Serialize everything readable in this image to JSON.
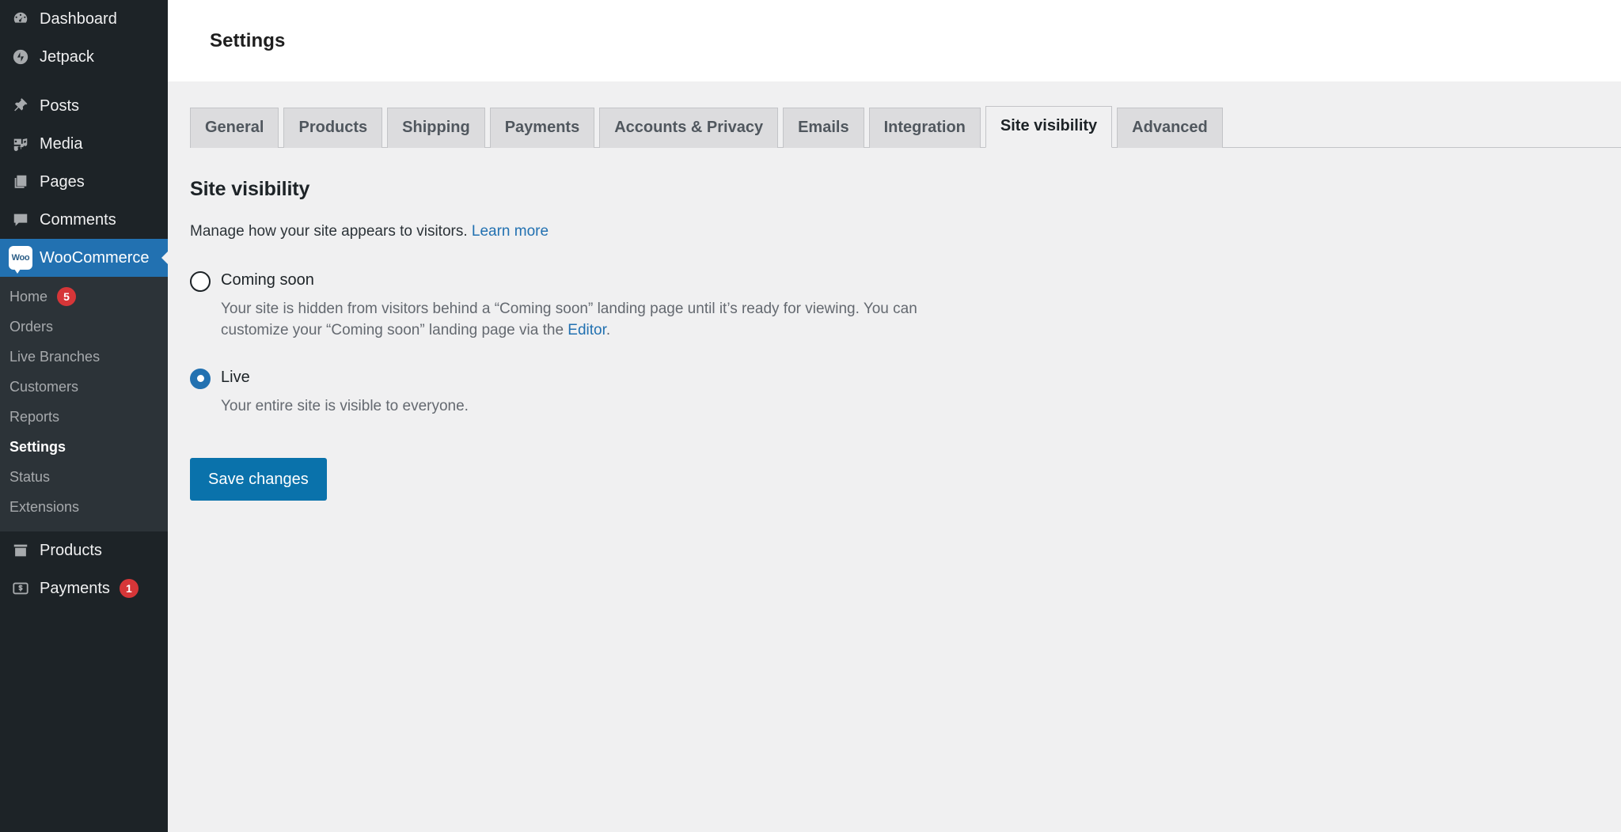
{
  "sidebar": {
    "items": [
      {
        "label": "Dashboard",
        "icon": "dashboard-icon",
        "name": "sidebar-item-dashboard"
      },
      {
        "label": "Jetpack",
        "icon": "jetpack-icon",
        "name": "sidebar-item-jetpack"
      },
      {
        "label": "Posts",
        "icon": "pin-icon",
        "name": "sidebar-item-posts"
      },
      {
        "label": "Media",
        "icon": "media-icon",
        "name": "sidebar-item-media"
      },
      {
        "label": "Pages",
        "icon": "pages-icon",
        "name": "sidebar-item-pages"
      },
      {
        "label": "Comments",
        "icon": "comment-icon",
        "name": "sidebar-item-comments"
      },
      {
        "label": "WooCommerce",
        "icon": "woocommerce-icon",
        "name": "sidebar-item-woocommerce",
        "current": true
      },
      {
        "label": "Products",
        "icon": "box-icon",
        "name": "sidebar-item-products"
      },
      {
        "label": "Payments",
        "icon": "dollar-card-icon",
        "name": "sidebar-item-payments",
        "count": "1"
      }
    ],
    "woo_icon_text": "Woo",
    "submenu": [
      {
        "label": "Home",
        "count": "5"
      },
      {
        "label": "Orders"
      },
      {
        "label": "Live Branches"
      },
      {
        "label": "Customers"
      },
      {
        "label": "Reports"
      },
      {
        "label": "Settings",
        "active": true
      },
      {
        "label": "Status"
      },
      {
        "label": "Extensions"
      }
    ]
  },
  "header": {
    "title": "Settings"
  },
  "tabs": [
    {
      "label": "General"
    },
    {
      "label": "Products"
    },
    {
      "label": "Shipping"
    },
    {
      "label": "Payments"
    },
    {
      "label": "Accounts & Privacy"
    },
    {
      "label": "Emails"
    },
    {
      "label": "Integration"
    },
    {
      "label": "Site visibility",
      "active": true
    },
    {
      "label": "Advanced"
    }
  ],
  "main": {
    "heading": "Site visibility",
    "description_before_link": "Manage how your site appears to visitors. ",
    "learn_more_label": "Learn more",
    "options": [
      {
        "label": "Coming soon",
        "checked": false,
        "help_before_link": "Your site is hidden from visitors behind a “Coming soon” landing page until it’s ready for viewing. You can customize your “Coming soon” landing page via the ",
        "help_link_label": "Editor",
        "help_after_link": "."
      },
      {
        "label": "Live",
        "checked": true,
        "help_before_link": "Your entire site is visible to everyone.",
        "help_link_label": "",
        "help_after_link": ""
      }
    ],
    "save_button": "Save changes"
  },
  "colors": {
    "sidebar_bg": "#1d2327",
    "submenu_bg": "#2c3338",
    "accent_blue": "#2271b1",
    "button_blue": "#0a72ab",
    "badge_red": "#d63638",
    "page_bg": "#f0f0f1"
  }
}
